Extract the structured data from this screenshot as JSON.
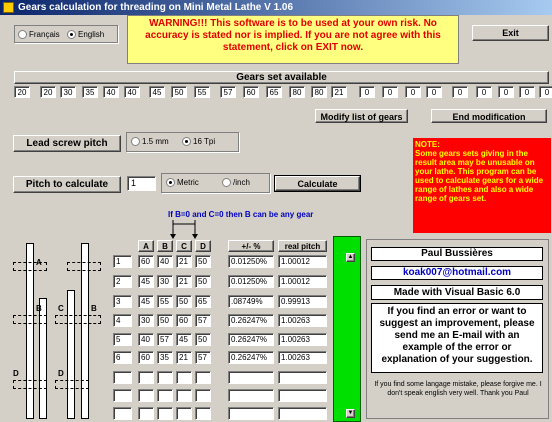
{
  "window": {
    "title": "Gears calculation for threading on Mini Metal Lathe     V 1.06"
  },
  "language": {
    "options": [
      "Français",
      "English"
    ],
    "selected": "English"
  },
  "warning": "WARNING!!! This software is to be used at your own risk. No accuracy is stated nor is implied. If you are not agree with this statement, click on EXIT now.",
  "exit_label": "Exit",
  "gears": {
    "title": "Gears set available",
    "values": [
      "20",
      "20",
      "30",
      "35",
      "40",
      "40",
      "45",
      "50",
      "55",
      "57",
      "60",
      "65",
      "80",
      "80",
      "21",
      "0",
      "0",
      "0",
      "0",
      "0",
      "0",
      "0",
      "0",
      "0"
    ]
  },
  "modify_label": "Modify list of gears",
  "end_mod_label": "End modification",
  "lead_screw": {
    "label": "Lead screw pitch",
    "options": [
      "1.5 mm",
      "16 Tpi"
    ],
    "selected": "16 Tpi"
  },
  "pitch": {
    "label": "Pitch to calculate",
    "value": "1",
    "units": [
      "Metric",
      "/inch"
    ],
    "selected": "Metric",
    "calculate_label": "Calculate"
  },
  "note": "NOTE:\nSome gears sets giving in the result area may be unusable on your lathe. This program can be used to calculate gears for a wide range of lathes and also a wide range of gears set.",
  "hint": "If B=0 and C=0 then B can be any gear",
  "table": {
    "headers": [
      "A",
      "B",
      "C",
      "D",
      "+/- %",
      "real pitch"
    ],
    "rows": [
      {
        "n": "1",
        "cells": [
          "60",
          "40",
          "21",
          "50",
          "0.01250%",
          "1.00012"
        ]
      },
      {
        "n": "2",
        "cells": [
          "45",
          "30",
          "21",
          "50",
          "0.01250%",
          "1.00012"
        ]
      },
      {
        "n": "3",
        "cells": [
          "45",
          "55",
          "50",
          "65",
          ".08749%",
          "0.99913"
        ]
      },
      {
        "n": "4",
        "cells": [
          "30",
          "50",
          "60",
          "57",
          "0.26247%",
          "1.00263"
        ]
      },
      {
        "n": "5",
        "cells": [
          "40",
          "57",
          "45",
          "50",
          "0.26247%",
          "1.00263"
        ]
      },
      {
        "n": "6",
        "cells": [
          "60",
          "35",
          "21",
          "57",
          "0.26247%",
          "1.00263"
        ]
      },
      {
        "n": "",
        "cells": [
          "",
          "",
          "",
          "",
          "",
          ""
        ]
      },
      {
        "n": "",
        "cells": [
          "",
          "",
          "",
          "",
          "",
          ""
        ]
      },
      {
        "n": "",
        "cells": [
          "",
          "",
          "",
          "",
          "",
          ""
        ]
      }
    ]
  },
  "diagram_labels": [
    "A",
    "B",
    "C",
    "B",
    "D",
    "D"
  ],
  "author": {
    "name": "Paul Bussières",
    "email": "koak007@hotmail.com",
    "made_with": "Made with Visual Basic 6.0",
    "message": "If you find an error or want to suggest an improvement, please send me an E-mail with an example of the error or explanation of your suggestion.",
    "language_note": "If you find some langage mistake, please forgive me. I don't speak english very well. Thank you Paul"
  },
  "colors": {
    "warning_bg": "#ffff80",
    "warning_text": "#e00000",
    "note_bg": "#ff0000",
    "note_text": "#ffff00",
    "scroll_bg": "#00e000",
    "hint_text": "#0000c0",
    "email_text": "#0000c0"
  }
}
